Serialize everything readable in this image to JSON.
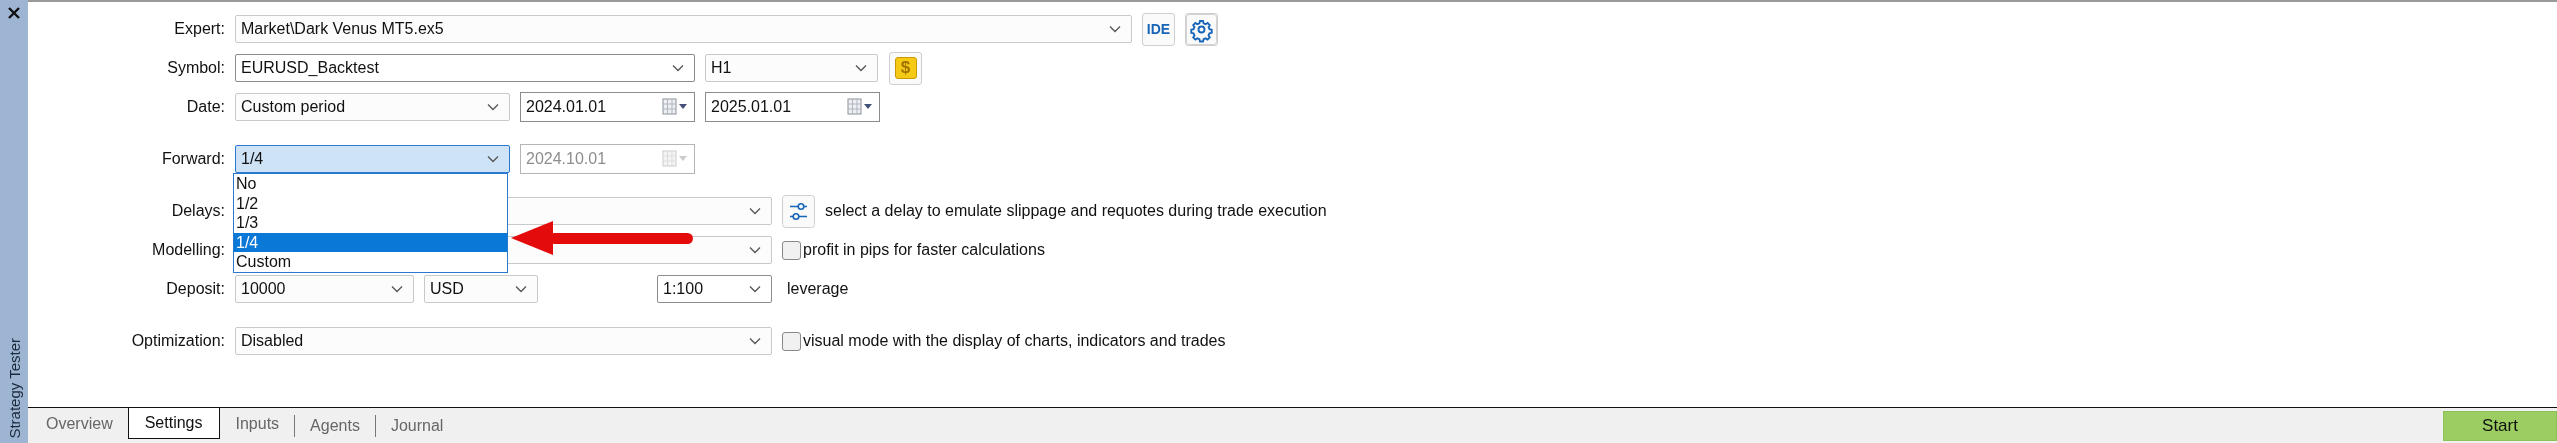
{
  "side_panel": {
    "title": "Strategy Tester"
  },
  "form": {
    "expert": {
      "label": "Expert:",
      "value": "Market\\Dark Venus MT5.ex5",
      "ide_button": "IDE"
    },
    "symbol": {
      "label": "Symbol:",
      "value": "EURUSD_Backtest",
      "timeframe": "H1",
      "currency_button": "$"
    },
    "date": {
      "label": "Date:",
      "value": "Custom period",
      "from": "2024.01.01",
      "to": "2025.01.01"
    },
    "forward": {
      "label": "Forward:",
      "value": "1/4",
      "focused": true,
      "date": "2024.10.01",
      "date_disabled": true,
      "dropdown": {
        "expanded": true,
        "options": [
          {
            "label": "No",
            "selected": false
          },
          {
            "label": "1/2",
            "selected": false
          },
          {
            "label": "1/3",
            "selected": false
          },
          {
            "label": "1/4",
            "selected": true
          },
          {
            "label": "Custom",
            "selected": false
          }
        ]
      }
    },
    "delays": {
      "label": "Delays:",
      "hint": "select a delay to emulate slippage and requotes during trade execution"
    },
    "modelling": {
      "label": "Modelling:",
      "checkbox": {
        "label": "profit in pips for faster calculations",
        "checked": false
      }
    },
    "deposit": {
      "label": "Deposit:",
      "value": "10000",
      "currency": "USD",
      "leverage_value": "1:100",
      "leverage_label": "leverage"
    },
    "optimization": {
      "label": "Optimization:",
      "value": "Disabled",
      "checkbox": {
        "label": "visual mode with the display of charts, indicators and trades",
        "checked": false
      }
    }
  },
  "annotations": [
    {
      "kind": "arrow"
    }
  ],
  "tabs": [
    {
      "label": "Overview",
      "selected": false
    },
    {
      "label": "Settings",
      "selected": true
    },
    {
      "label": "Inputs",
      "selected": false
    },
    {
      "label": "Agents",
      "selected": false
    },
    {
      "label": "Journal",
      "selected": false
    }
  ],
  "start_button": "Start"
}
